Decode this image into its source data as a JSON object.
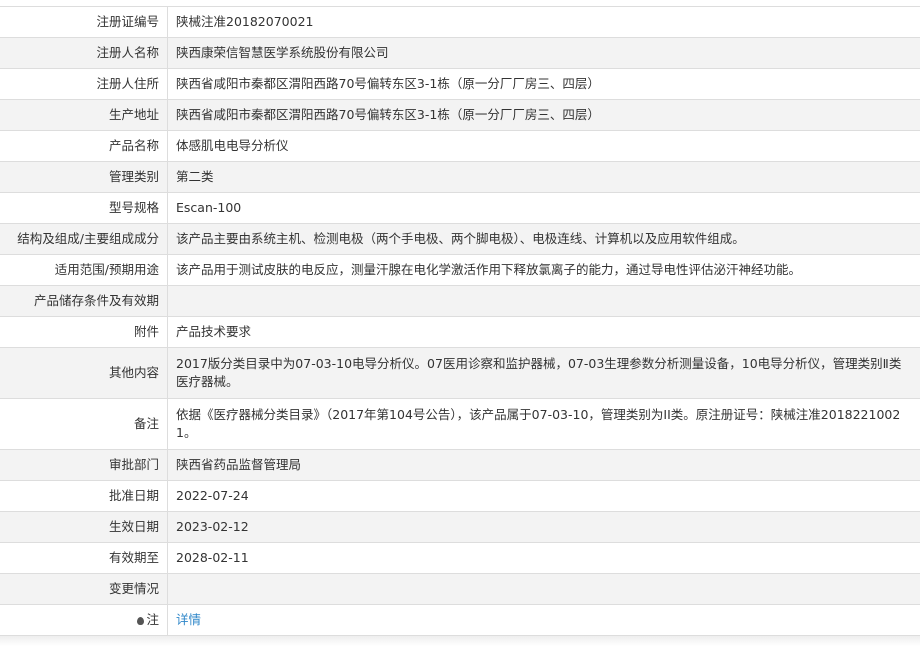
{
  "rows": [
    {
      "key": "registration_no",
      "label": "注册证编号",
      "value": "陕械注准20182070021"
    },
    {
      "key": "registrant_name",
      "label": "注册人名称",
      "value": "陕西康荣信智慧医学系统股份有限公司"
    },
    {
      "key": "registrant_address",
      "label": "注册人住所",
      "value": "陕西省咸阳市秦都区渭阳西路70号偏转东区3-1栋（原一分厂厂房三、四层）"
    },
    {
      "key": "production_address",
      "label": "生产地址",
      "value": "陕西省咸阳市秦都区渭阳西路70号偏转东区3-1栋（原一分厂厂房三、四层）"
    },
    {
      "key": "product_name",
      "label": "产品名称",
      "value": "体感肌电电导分析仪"
    },
    {
      "key": "management_class",
      "label": "管理类别",
      "value": "第二类"
    },
    {
      "key": "model_spec",
      "label": "型号规格",
      "value": "Escan-100"
    },
    {
      "key": "structure",
      "label": "结构及组成/主要组成成分",
      "value": "该产品主要由系统主机、检测电极（两个手电极、两个脚电极）、电极连线、计算机以及应用软件组成。"
    },
    {
      "key": "intended_use",
      "label": "适用范围/预期用途",
      "value": "该产品用于测试皮肤的电反应，测量汗腺在电化学激活作用下释放氯离子的能力，通过导电性评估泌汗神经功能。"
    },
    {
      "key": "storage",
      "label": "产品储存条件及有效期",
      "value": ""
    },
    {
      "key": "attachment",
      "label": "附件",
      "value": "产品技术要求"
    },
    {
      "key": "other",
      "label": "其他内容",
      "value": "2017版分类目录中为07-03-10电导分析仪。07医用诊察和监护器械，07-03生理参数分析测量设备，10电导分析仪，管理类别Ⅱ类医疗器械。"
    },
    {
      "key": "remarks",
      "label": "备注",
      "value": "依据《医疗器械分类目录》（2017年第104号公告），该产品属于07-03-10，管理类别为II类。原注册证号：陕械注准20182210021。"
    },
    {
      "key": "approval_dept",
      "label": "审批部门",
      "value": "陕西省药品监督管理局"
    },
    {
      "key": "approval_date",
      "label": "批准日期",
      "value": "2022-07-24"
    },
    {
      "key": "effective_date",
      "label": "生效日期",
      "value": "2023-02-12"
    },
    {
      "key": "expiry_date",
      "label": "有效期至",
      "value": "2028-02-11"
    },
    {
      "key": "change_info",
      "label": "变更情况",
      "value": ""
    }
  ],
  "note": {
    "label": "注",
    "link_text": "详情",
    "icon": "lightbulb-icon"
  },
  "colors": {
    "link": "#2f87c9",
    "stripe": "#f3f3f3",
    "border": "#dddddd",
    "text": "#333333"
  }
}
